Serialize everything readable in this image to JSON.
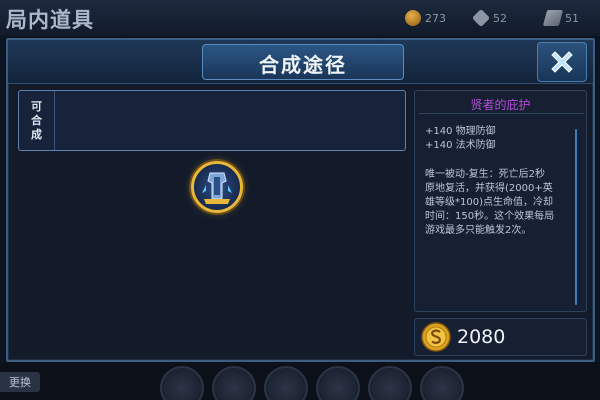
{
  "background": {
    "title": "局内道具",
    "currencies": [
      {
        "icon": "gold-coin-icon",
        "value": "273"
      },
      {
        "icon": "diamond-icon",
        "value": "52"
      },
      {
        "icon": "voucher-icon",
        "value": "51"
      }
    ],
    "swap_label": "更换"
  },
  "dialog": {
    "title": "合成途径",
    "close_icon": "close-x-icon",
    "synth_label": [
      "可",
      "合",
      "成"
    ],
    "item_icon": "hero-armor-item-icon"
  },
  "item": {
    "name": "贤者的庇护",
    "name_color": "#b54cd8",
    "stats": [
      "+140 物理防御",
      "+140 法术防御"
    ],
    "description_lines": [
      "唯一被动-复生：死亡后2秒",
      "原地复活，并获得(2000+英",
      "雄等级*100)点生命值，冷却",
      "时间：150秒。这个效果每局",
      "游戏最多只能触发2次。"
    ],
    "price": "2080",
    "price_icon": "gold-coin-icon"
  },
  "colors": {
    "accent": "#3b5f83",
    "title_text": "#eef4fc",
    "gold": "#e8b83a"
  }
}
